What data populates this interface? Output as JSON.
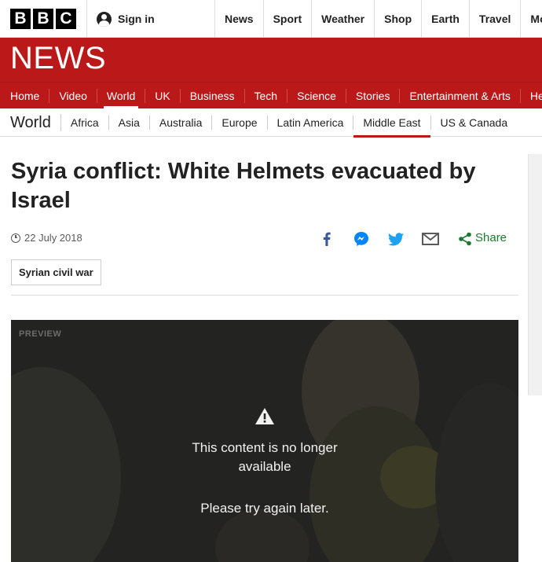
{
  "topbar": {
    "logo_letters": [
      "B",
      "B",
      "C"
    ],
    "signin_label": "Sign in",
    "nav": [
      "News",
      "Sport",
      "Weather",
      "Shop",
      "Earth",
      "Travel",
      "More"
    ]
  },
  "news_header": {
    "title": "NEWS"
  },
  "primary_nav": {
    "items": [
      "Home",
      "Video",
      "World",
      "UK",
      "Business",
      "Tech",
      "Science",
      "Stories",
      "Entertainment & Arts",
      "He"
    ],
    "active": "World"
  },
  "secondary_nav": {
    "title": "World",
    "items": [
      "Africa",
      "Asia",
      "Australia",
      "Europe",
      "Latin America",
      "Middle East",
      "US & Canada"
    ],
    "active": "Middle East"
  },
  "article": {
    "headline": "Syria conflict: White Helmets evacuated by Israel",
    "date": "22 July 2018",
    "share_label": "Share",
    "tag": "Syrian civil war"
  },
  "video": {
    "preview_label": "PREVIEW",
    "message": "This content is no longer available",
    "retry": "Please try again later."
  },
  "colors": {
    "brand_red": "#bb1919",
    "share_green": "#1a7a2d",
    "facebook": "#3b5998",
    "messenger": "#0084ff",
    "twitter": "#1da1f2"
  },
  "icons": [
    "user-icon",
    "clock-icon",
    "facebook-icon",
    "messenger-icon",
    "twitter-icon",
    "email-icon",
    "share-icon",
    "warning-icon"
  ]
}
